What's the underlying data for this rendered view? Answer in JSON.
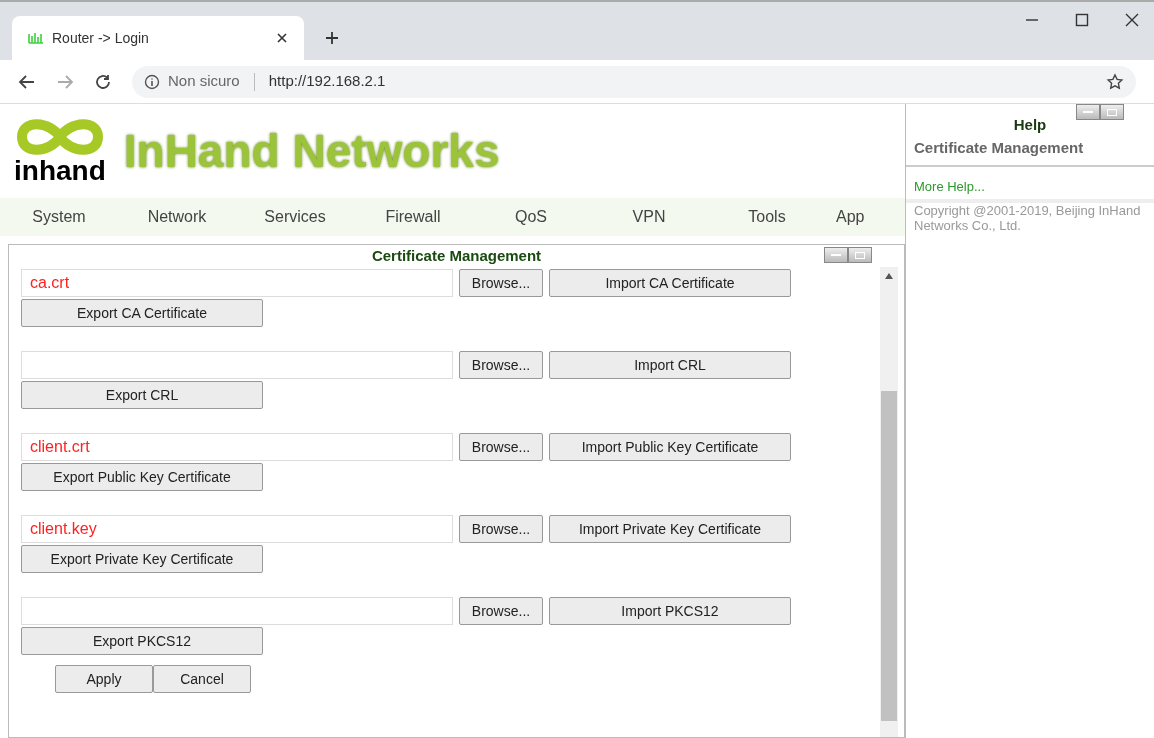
{
  "browser": {
    "tab_title": "Router -> Login",
    "security": "Non sicuro",
    "url": "http://192.168.2.1"
  },
  "header": {
    "logo_word": "inhand",
    "brand": "InHand Networks"
  },
  "nav": [
    "System",
    "Network",
    "Services",
    "Firewall",
    "QoS",
    "VPN",
    "Tools",
    "App"
  ],
  "panel": {
    "title": "Certificate Management",
    "groups": [
      {
        "file": "ca.crt",
        "browse": "Browse...",
        "import": "Import CA Certificate",
        "export": "Export CA Certificate"
      },
      {
        "browse": "Browse...",
        "import": "Import CRL",
        "export": "Export CRL"
      },
      {
        "file": "client.crt",
        "browse": "Browse...",
        "import": "Import Public Key Certificate",
        "export": "Export Public Key Certificate"
      },
      {
        "file": "client.key",
        "browse": "Browse...",
        "import": "Import Private Key Certificate",
        "export": "Export Private Key Certificate"
      },
      {
        "browse": "Browse...",
        "import": "Import PKCS12",
        "export": "Export PKCS12"
      }
    ],
    "actions": [
      "Apply",
      "Cancel"
    ]
  },
  "help": {
    "title": "Help",
    "topic": "Certificate Management",
    "link": "More Help...",
    "copyright": "Copyright @2001-2019, Beijing InHand Networks Co., Ltd."
  }
}
